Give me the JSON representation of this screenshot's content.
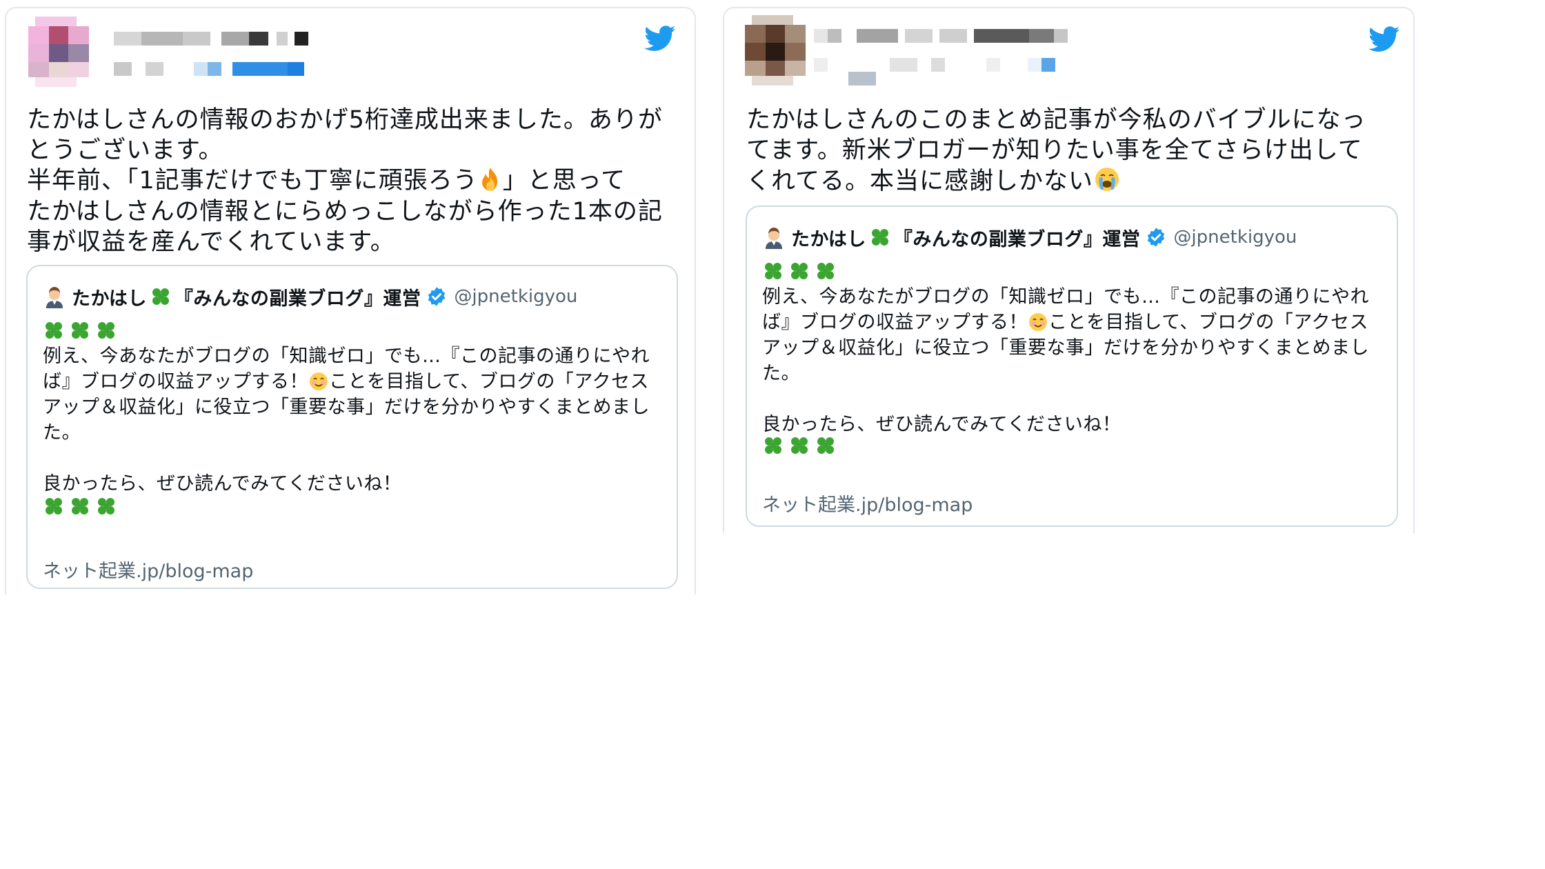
{
  "tweets": [
    {
      "text_line1": "たかはしさんの情報のおかげ5桁達成出来ました。ありが",
      "text_line2": "とうございます。",
      "text_line3a": "半年前、「1記事だけでも丁寧に頑張ろう",
      "text_line3b": "」と思って",
      "text_line4": "たかはしさんの情報とにらめっこしながら作った1本の記",
      "text_line5": "事が収益を産んでくれています。",
      "emoji": "fire-emoji",
      "quote": {
        "name": "たかはし",
        "name_suffix": "『みんなの副業ブログ』運営",
        "handle": "@jpnetkigyou",
        "body_line1": "例え、今あなたがブログの「知識ゼロ」でも…『この記事の通りにやれ",
        "body_line2a": "ば』ブログの収益アップする！",
        "body_line2b": "ことを目指して、ブログの「アクセス",
        "body_line3": "アップ＆収益化」に役立つ「重要な事」だけを分かりやすくまとめまし",
        "body_line4": "た。",
        "body_line5": "良かったら、ぜひ読んでみてくださいね！",
        "link": "ネット起業.jp/blog-map"
      }
    },
    {
      "text_line1": "たかはしさんのこのまとめ記事が今私のバイブルになっ",
      "text_line2": "てます。新米ブロガーが知りたい事を全てさらけ出して",
      "text_line3": "くれてる。本当に感謝しかない",
      "emoji": "crying-emoji",
      "quote": {
        "name": "たかはし",
        "name_suffix": "『みんなの副業ブログ』運営",
        "handle": "@jpnetkigyou",
        "body_line1": "例え、今あなたがブログの「知識ゼロ」でも…『この記事の通りにやれ",
        "body_line2a": "ば』ブログの収益アップする！",
        "body_line2b": "ことを目指して、ブログの「アクセス",
        "body_line3": "アップ＆収益化」に役立つ「重要な事」だけを分かりやすくまとめまし",
        "body_line4": "た。",
        "body_line5": "良かったら、ぜひ読んでみてくださいね！",
        "link": "ネット起業.jp/blog-map"
      }
    }
  ],
  "colors": {
    "twitter_blue": "#1d9bf0",
    "clover_green": "#3aa530",
    "border": "#cfd9de",
    "handle_gray": "#536471"
  }
}
